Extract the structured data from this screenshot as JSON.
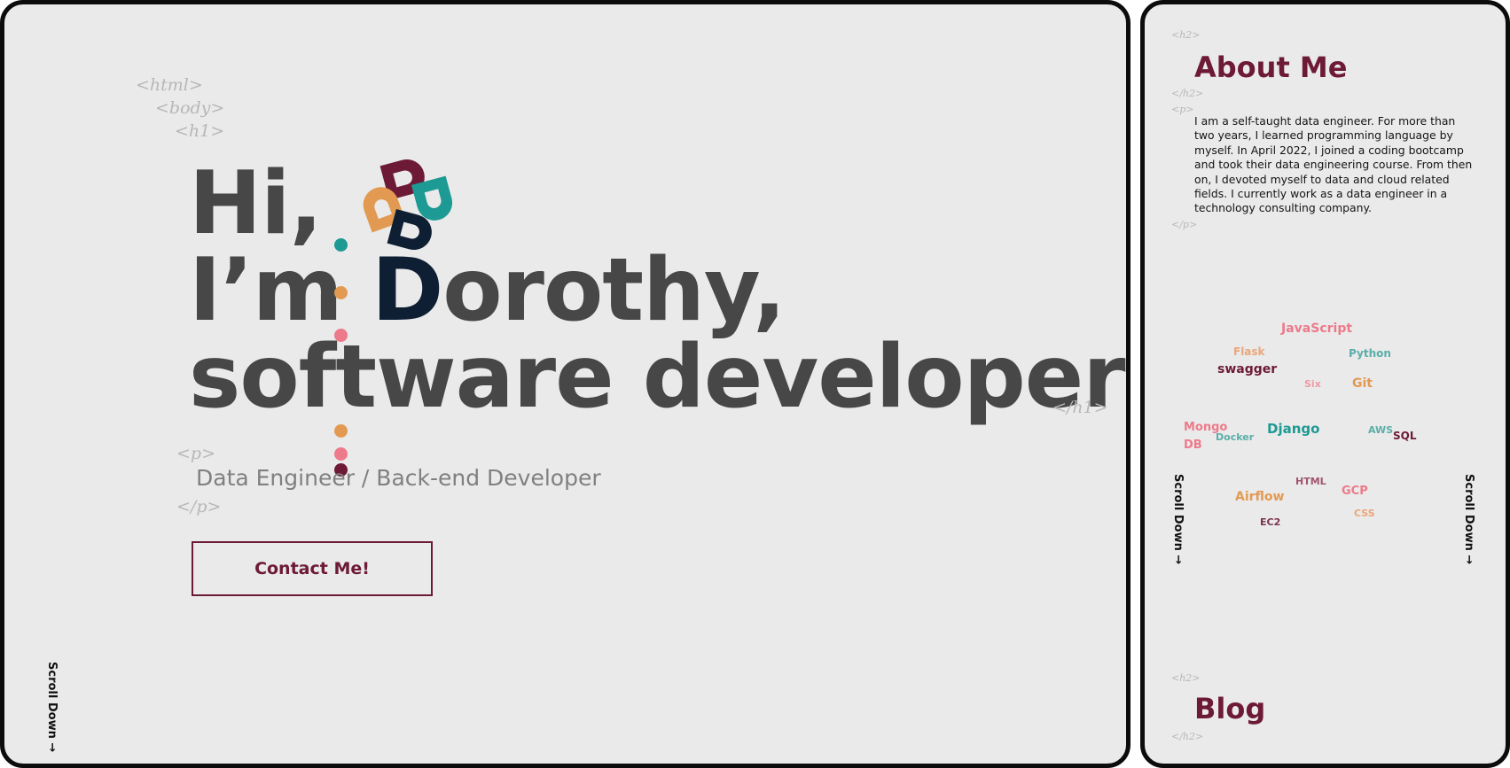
{
  "hero": {
    "tags": {
      "html": "<html>",
      "body": "<body>",
      "h1_open": "<h1>",
      "h1_close": "</h1>",
      "p_open": "<p>",
      "p_close": "</p>"
    },
    "headline": {
      "line1": "Hi,",
      "line2_prefix": "I’m ",
      "line2_initial": "D",
      "line2_rest": "orothy,",
      "line3": "software developer"
    },
    "subtitle": "Data Engineer / Back-end Developer",
    "contact_label": "Contact Me!",
    "scroll_label": "Scroll Down →",
    "colors": {
      "teal": "#1d9a93",
      "orange": "#e29a52",
      "pink": "#ec7a8a",
      "maroon": "#6d1a36",
      "navy": "#0e1e33"
    }
  },
  "about": {
    "tags": {
      "h2_open": "<h2>",
      "h2_close": "</h2>",
      "p_open": "<p>",
      "p_close": "</p>"
    },
    "title": "About Me",
    "body": "I am a self-taught data engineer. For more than two years, I learned programming language by myself. In April 2022, I joined a coding bootcamp and took their data engineering course. From then on, I devoted myself to data and cloud related fields. I currently work as a data engineer in a technology consulting company.",
    "skills": [
      {
        "label": "JavaScript",
        "color": "#ec7a8a"
      },
      {
        "label": "Flask",
        "color": "#e9a67a"
      },
      {
        "label": "Python",
        "color": "#5aaea9"
      },
      {
        "label": "swagger",
        "color": "#6d1a36"
      },
      {
        "label": "Six",
        "color": "#ee9aa8"
      },
      {
        "label": "Git",
        "color": "#e29a52"
      },
      {
        "label": "Mongo",
        "color": "#ec7a8a"
      },
      {
        "label": "DB",
        "color": "#ec7a8a"
      },
      {
        "label": "Docker",
        "color": "#5aaea9"
      },
      {
        "label": "Django",
        "color": "#1d9a93"
      },
      {
        "label": "AWS",
        "color": "#5aaea9"
      },
      {
        "label": "SQL",
        "color": "#6d1a36"
      },
      {
        "label": "HTML",
        "color": "#a05570"
      },
      {
        "label": "GCP",
        "color": "#ec7a8a"
      },
      {
        "label": "Airflow",
        "color": "#e29a52"
      },
      {
        "label": "CSS",
        "color": "#e9a67a"
      },
      {
        "label": "EC2",
        "color": "#7a3450"
      }
    ],
    "scroll_label": "Scroll Down →"
  },
  "blog": {
    "tags": {
      "h2_open": "<h2>",
      "h2_close": "</h2>"
    },
    "title": "Blog"
  }
}
